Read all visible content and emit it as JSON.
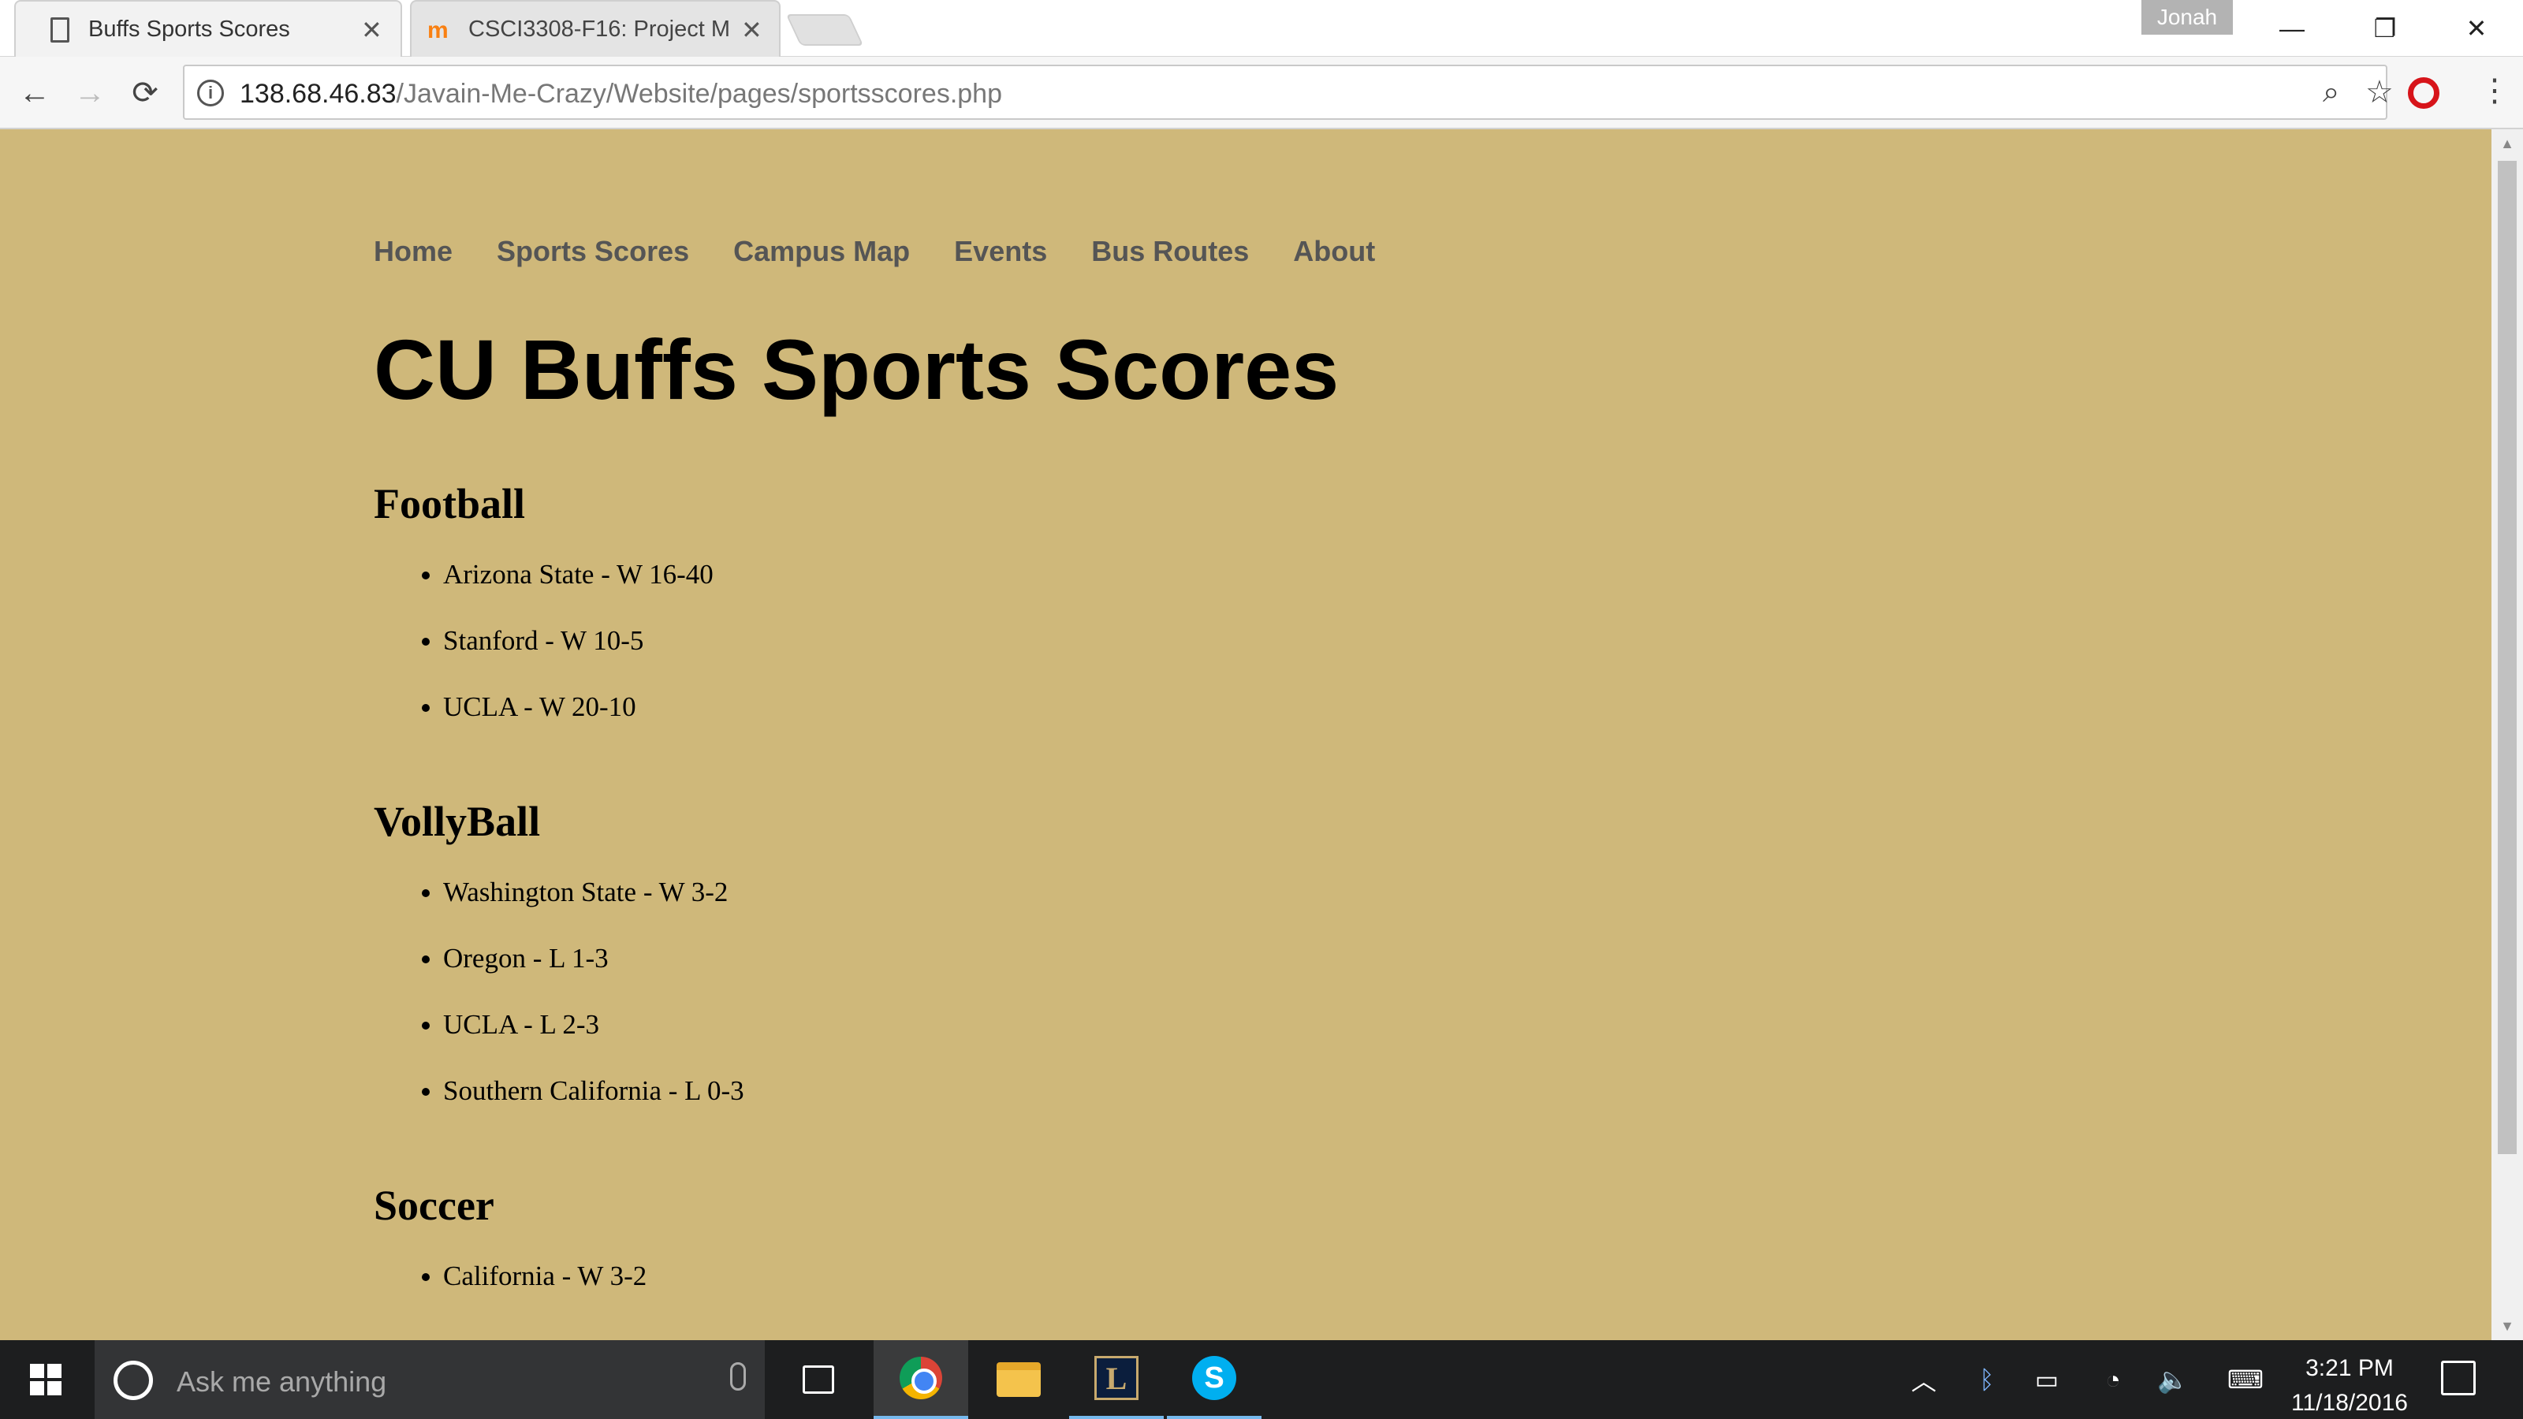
{
  "browser": {
    "tabs": [
      {
        "title": "Buffs Sports Scores",
        "active": true
      },
      {
        "title": "CSCI3308-F16: Project M",
        "active": false
      }
    ],
    "profile_name": "Jonah",
    "url_host": "138.68.46.83",
    "url_path": "/Javain-Me-Crazy/Website/pages/sportsscores.php"
  },
  "site": {
    "nav": [
      "Home",
      "Sports Scores",
      "Campus Map",
      "Events",
      "Bus Routes",
      "About"
    ],
    "title": "CU Buffs Sports Scores",
    "sports": [
      {
        "name": "Football",
        "results": [
          "Arizona State - W 16-40",
          "Stanford - W 10-5",
          "UCLA - W 20-10"
        ]
      },
      {
        "name": "VollyBall",
        "results": [
          "Washington State - W 3-2",
          "Oregon - L 1-3",
          "UCLA - L 2-3",
          "Southern California - L 0-3"
        ]
      },
      {
        "name": "Soccer",
        "results": [
          "California - W 3-2"
        ]
      }
    ],
    "colors": {
      "background": "#cfb87a",
      "nav_link": "#555555",
      "text": "#000000"
    }
  },
  "taskbar": {
    "search_placeholder": "Ask me anything",
    "time": "3:21 PM",
    "date": "11/18/2016",
    "pinned": [
      "chrome-icon",
      "file-explorer-icon",
      "league-of-legends-icon",
      "skype-icon"
    ]
  }
}
